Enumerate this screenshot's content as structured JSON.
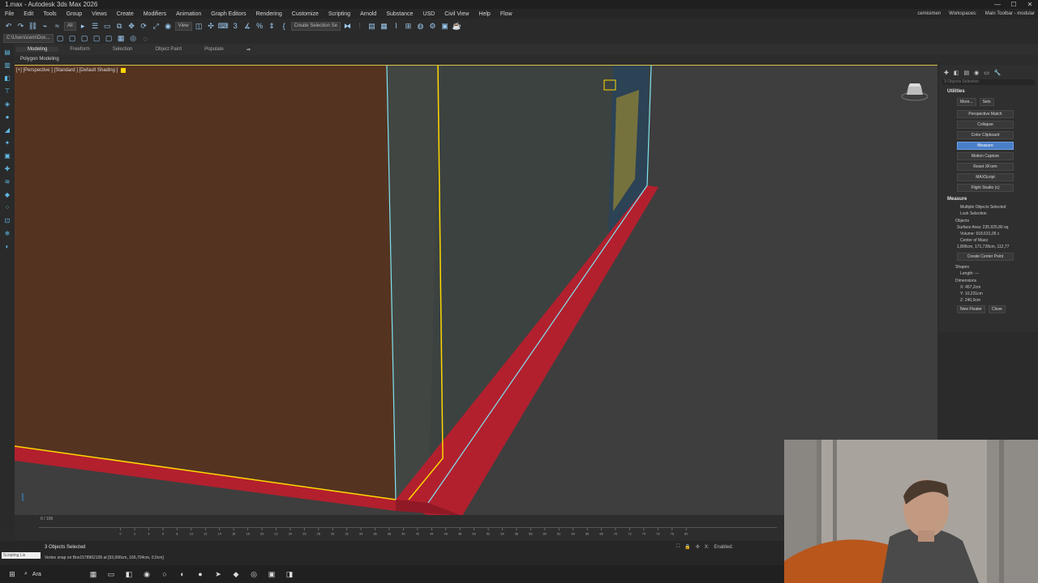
{
  "window": {
    "title": "1.max - Autodesk 3ds Max 2026",
    "controls": [
      "—",
      "☐",
      "✕"
    ]
  },
  "menubar": {
    "items": [
      "File",
      "Edit",
      "Tools",
      "Group",
      "Views",
      "Create",
      "Modifiers",
      "Animation",
      "Graph Editors",
      "Rendering",
      "Customize",
      "Scripting",
      "Arnold",
      "Substance",
      "USD",
      "Civil View",
      "Help",
      "Flow"
    ],
    "user": "cemisimen",
    "workspaces_label": "Workspaces:",
    "workspace": "Main Toolbar - modular"
  },
  "toolbar": {
    "filter_value": "All",
    "refcoord_value": "View",
    "selset_placeholder": "Create Selection Se"
  },
  "toolbar2": {
    "path": "C:\\Users\\cem\\Doc..."
  },
  "ribbon": {
    "tabs": [
      "Modeling",
      "Freeform",
      "Selection",
      "Object Paint",
      "Populate"
    ],
    "active_tab": "Modeling",
    "panel": "Polygon Modeling"
  },
  "viewport": {
    "label": "[+] [Perspective ] [Standard ] [Default Shading ]"
  },
  "command_panel": {
    "search_placeholder": "3 Objects Selection",
    "utilities_title": "Utilities",
    "more_label": "More...",
    "sets_label": "Sets",
    "buttons": [
      "Perspective Match",
      "Collapse",
      "Color Clipboard",
      "Measure",
      "Motion Capture",
      "Reset XForm",
      "MAXScript",
      "Flight Studio (c)"
    ],
    "selected_button": "Measure",
    "measure": {
      "title": "Measure",
      "status": "Multiple Objects Selected",
      "lock_selection": "Lock Selection",
      "objects_label": "Objects",
      "surface_area": "Surface Area: 235.925,80 sq",
      "volume": "Volume: 918.631,06 c",
      "center_label": "Center of Mass:",
      "center_value": "1,896cm, 171,728cm, 112,77",
      "create_center": "Create Center Point",
      "shapes_label": "Shapes",
      "length": "Length: ---",
      "dimensions_label": "Dimensions",
      "dim_x": "X: 457,2cm",
      "dim_y": "Y: 10,231cm",
      "dim_z": "Z: 240,0cm",
      "new_floater": "New Floater",
      "close": "Close"
    }
  },
  "timeline": {
    "frame_display": "0 / 100",
    "ticks": [
      "0",
      "2",
      "4",
      "6",
      "8",
      "10",
      "12",
      "14",
      "16",
      "18",
      "20",
      "22",
      "24",
      "26",
      "28",
      "30",
      "32",
      "34",
      "36",
      "38",
      "40",
      "42",
      "44",
      "46",
      "48",
      "50",
      "52",
      "54",
      "56",
      "58",
      "60",
      "62",
      "64",
      "66",
      "68",
      "70",
      "72",
      "74",
      "76",
      "78",
      "80"
    ]
  },
  "status": {
    "main": "3 Objects Selected",
    "prompt": "Vertex snap on Box1578962106 at [93,066cm, 166,704cm, 0,0cm]",
    "script_listener": "Scripting Lis",
    "enabled_label": "Enabled:"
  },
  "taskbar": {
    "search_label": "Ara"
  },
  "colors": {
    "floor_red": "#b2202e",
    "wall_brown": "#553321",
    "selection_yellow": "#ffd800",
    "edge_cyan": "#7fe4f2",
    "active_button": "#4a7fc7"
  }
}
